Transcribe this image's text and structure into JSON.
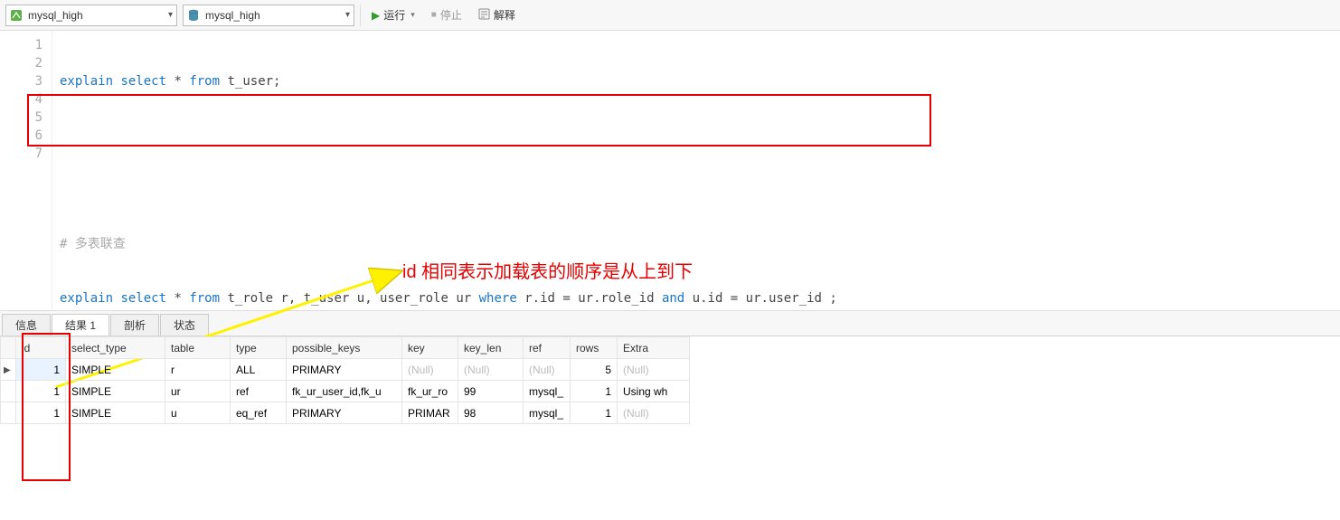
{
  "toolbar": {
    "connection": "mysql_high",
    "database": "mysql_high",
    "run_label": "运行",
    "stop_label": "停止",
    "explain_label": "解释"
  },
  "editor": {
    "line_count": 7,
    "lines": {
      "l1": {
        "pre": "",
        "kw1": "explain",
        "mid1": " ",
        "kw2": "select",
        "mid2": " * ",
        "kw3": "from",
        "post": " t_user;"
      },
      "l2": "",
      "l3": "",
      "l4": {
        "comment": "# 多表联查"
      },
      "l5": {
        "pre": "",
        "kw1": "explain",
        "mid1": " ",
        "kw2": "select",
        "mid2": " * ",
        "kw3": "from",
        "mid3": " t_role r, t_user u, user_role ur ",
        "kw4": "where",
        "mid4": " r.id = ur.role_id ",
        "kw5": "and",
        "post": " u.id = ur.user_id ;"
      },
      "l6": "",
      "l7": ""
    }
  },
  "annotation_text": "id 相同表示加载表的顺序是从上到下",
  "tabs": {
    "info": "信息",
    "result": "结果 1",
    "profile": "剖析",
    "status": "状态"
  },
  "table": {
    "headers": {
      "id": "id",
      "select_type": "select_type",
      "table": "table",
      "type": "type",
      "possible_keys": "possible_keys",
      "key": "key",
      "key_len": "key_len",
      "ref": "ref",
      "rows": "rows",
      "Extra": "Extra"
    },
    "rows": [
      {
        "id": "1",
        "select_type": "SIMPLE",
        "table": "r",
        "type": "ALL",
        "possible_keys": "PRIMARY",
        "key": "(Null)",
        "key_is_null": true,
        "key_len": "(Null)",
        "key_len_is_null": true,
        "ref": "(Null)",
        "ref_is_null": true,
        "rows": "5",
        "Extra": "(Null)",
        "extra_is_null": true
      },
      {
        "id": "1",
        "select_type": "SIMPLE",
        "table": "ur",
        "type": "ref",
        "possible_keys": "fk_ur_user_id,fk_u",
        "key": "fk_ur_ro",
        "key_is_null": false,
        "key_len": "99",
        "key_len_is_null": false,
        "ref": "mysql_",
        "ref_is_null": false,
        "rows": "1",
        "Extra": "Using wh",
        "extra_is_null": false
      },
      {
        "id": "1",
        "select_type": "SIMPLE",
        "table": "u",
        "type": "eq_ref",
        "possible_keys": "PRIMARY",
        "key": "PRIMAR",
        "key_is_null": false,
        "key_len": "98",
        "key_len_is_null": false,
        "ref": "mysql_",
        "ref_is_null": false,
        "rows": "1",
        "Extra": "(Null)",
        "extra_is_null": true
      }
    ]
  }
}
